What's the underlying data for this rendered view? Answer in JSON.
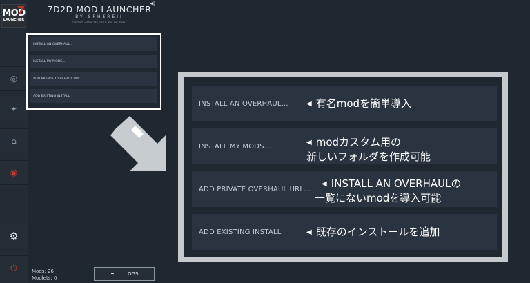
{
  "app": {
    "title": "7D2D MOD LAUNCHER",
    "byline": "BY SPHEREII",
    "default_path": "Default Folder: D:\\7D2D\\ 864 GB Avail."
  },
  "logo": {
    "big": "MOD",
    "small": "LAUNCHER",
    "seven": "7"
  },
  "sidebar": {
    "items": [
      {
        "icon": "discord-icon",
        "glyph": "◎"
      },
      {
        "icon": "twitter-icon",
        "glyph": "✦"
      },
      {
        "icon": "home-icon",
        "glyph": "⌂"
      },
      {
        "icon": "coin-icon",
        "glyph": "◉"
      },
      {
        "icon": "gear-icon",
        "glyph": "⚙"
      },
      {
        "icon": "power-icon",
        "glyph": "⏻"
      }
    ]
  },
  "menu": {
    "items": [
      "INSTALL AN OVERHAUL...",
      "INSTALL MY MODS...",
      "ADD PRIVATE OVERHAUL URL...",
      "ADD EXISTING INSTALL"
    ]
  },
  "notes": [
    {
      "line1": "有名modを簡単導入",
      "line2": ""
    },
    {
      "line1": "modカスタム用の",
      "line2": "新しいフォルダを作成可能"
    },
    {
      "line1": "INSTALL AN OVERHAULの",
      "line2": "一覧にないmodを導入可能"
    },
    {
      "line1": "既存のインストールを追加",
      "line2": ""
    }
  ],
  "footer": {
    "mods": "Mods: 26",
    "modlets": "Modlets: 0",
    "logs_label": "LOGS"
  },
  "colors": {
    "background": "#1f2731",
    "item_bg": "#2a3440",
    "highlight_border_small": "#ffffff",
    "highlight_border_big": "#c4c9cd",
    "accent_red": "#c0392b"
  }
}
